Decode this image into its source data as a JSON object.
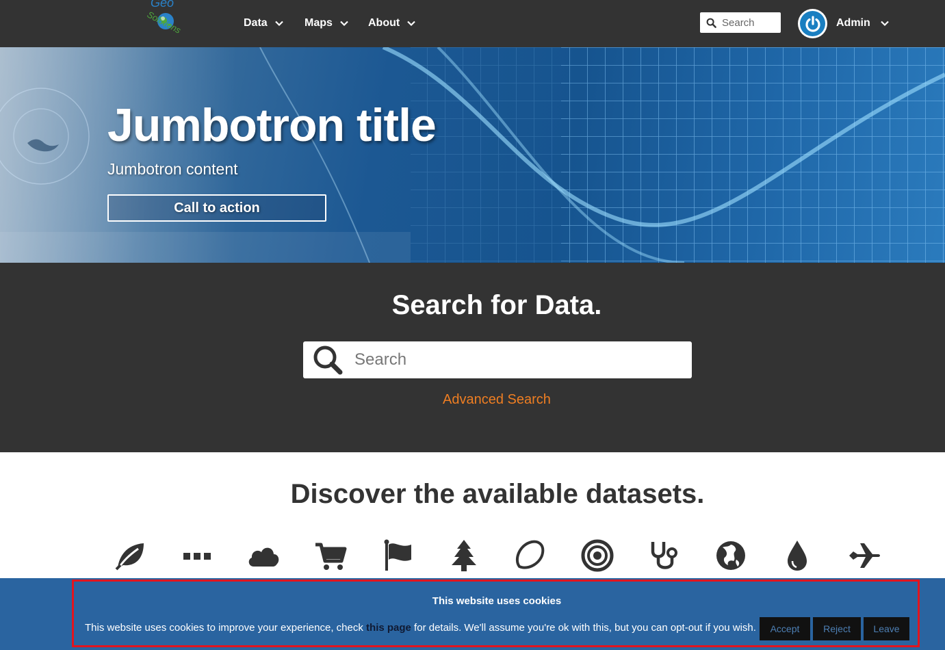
{
  "navbar": {
    "logo_text": "Geo Solutions",
    "menus": [
      {
        "label": "Data"
      },
      {
        "label": "Maps"
      },
      {
        "label": "About"
      }
    ],
    "search_placeholder": "Search",
    "user_label": "Admin"
  },
  "jumbotron": {
    "title": "Jumbotron title",
    "content": "Jumbotron content",
    "cta_label": "Call to action"
  },
  "search_section": {
    "title": "Search for Data.",
    "search_placeholder": "Search",
    "advanced_label": "Advanced Search"
  },
  "discover": {
    "title": "Discover the available datasets.",
    "icons": [
      "leaf-icon",
      "ellipsis-icon",
      "cloud-icon",
      "shopping-cart-icon",
      "flag-icon",
      "tree-icon",
      "lemon-icon",
      "bullseye-icon",
      "stethoscope-icon",
      "globe-icon",
      "tint-icon",
      "plane-icon"
    ]
  },
  "cookie_banner": {
    "title": "This website uses cookies",
    "text_before": "This website uses cookies to improve your experience, check ",
    "link_text": "this page",
    "text_after": " for details. We'll assume you're ok with this, but you can opt-out if you wish.",
    "accept_label": "Accept",
    "reject_label": "Reject",
    "leave_label": "Leave"
  },
  "colors": {
    "navbar_bg": "#333333",
    "accent_orange": "#ef7e22",
    "cookie_bg": "#2a64a0",
    "highlight_border": "#e3141e",
    "avatar_blue": "#1a7fc1"
  }
}
